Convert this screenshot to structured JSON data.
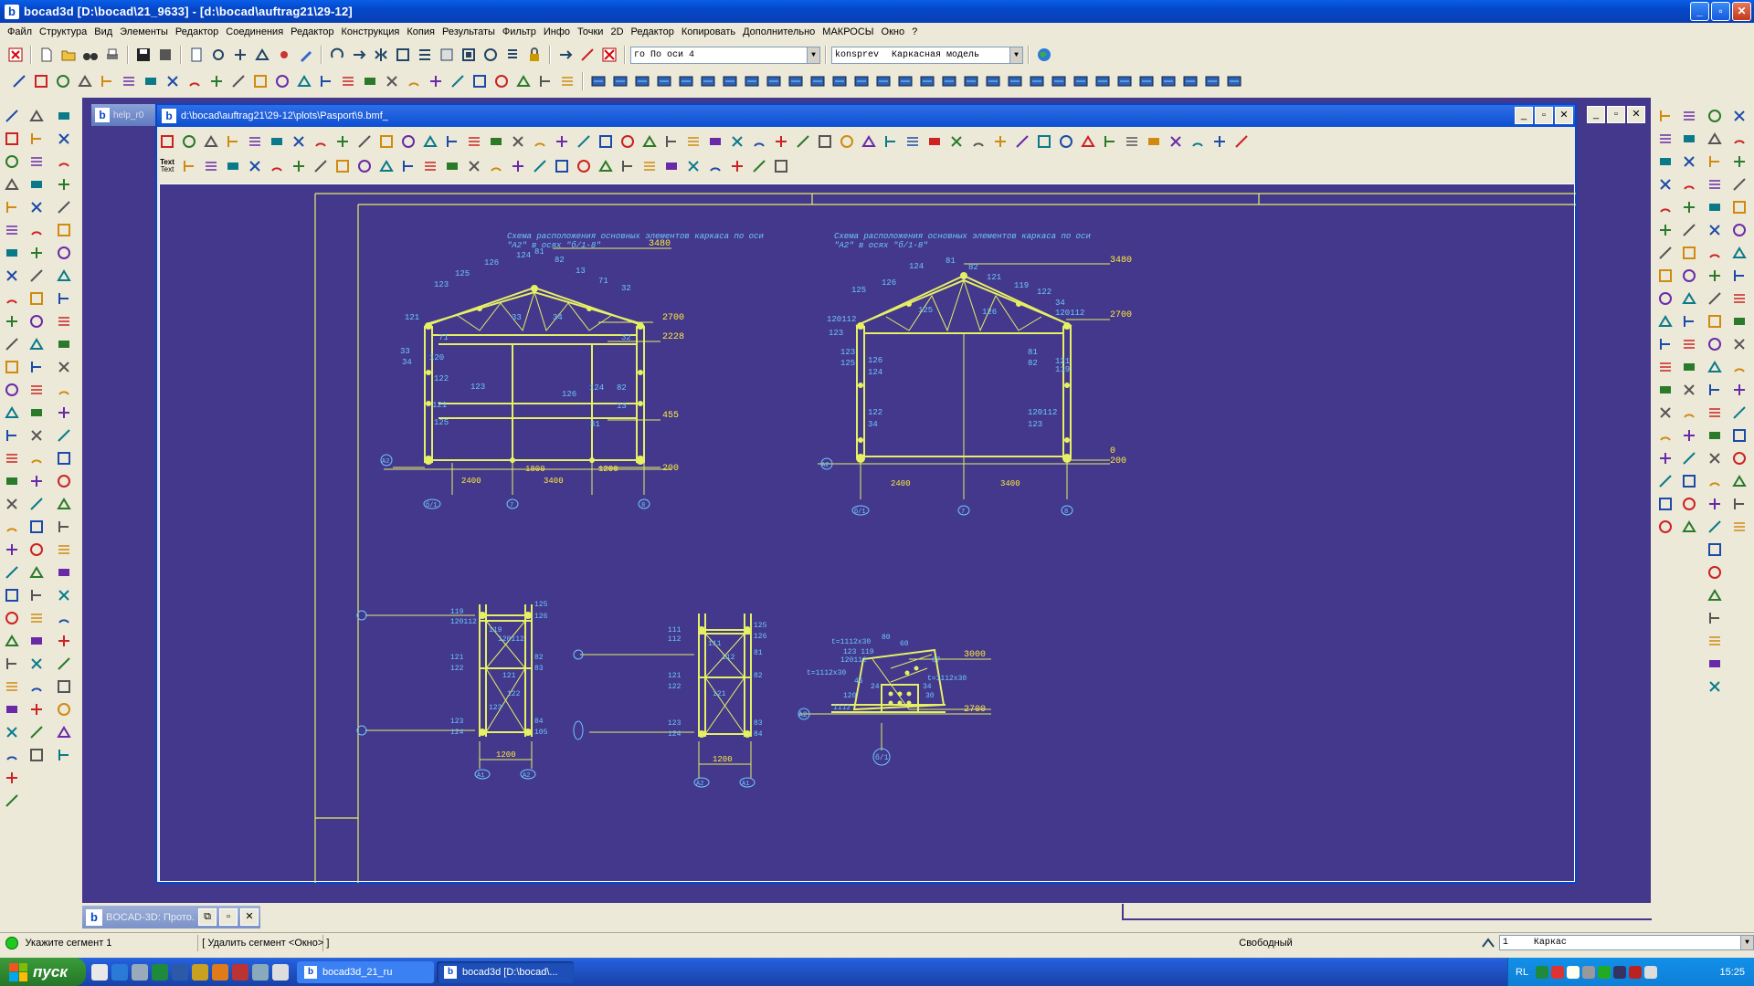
{
  "window": {
    "title": "bocad3d  [D:\\bocad\\21_9633]  - [d:\\bocad\\auftrag21\\29-12]",
    "app_letter": "b"
  },
  "menu": [
    "Файл",
    "Структура",
    "Вид",
    "Элементы",
    "Редактор",
    "Соединения",
    "Редактор",
    "Конструкция",
    "Копия",
    "Результаты",
    "Фильтр",
    "Инфо",
    "Точки",
    "2D",
    "Редактор",
    "Копировать",
    "Дополнительно",
    "МАКРОСЫ",
    "Окно",
    "?"
  ],
  "toolbar": {
    "view_combo": "го По оси 4",
    "layer_combo": "konsprev",
    "model_combo": "Каркасная модель"
  },
  "child": {
    "title": "d:\\bocad\\auftrag21\\29-12\\plots\\Pasport\\9.bmf_",
    "help_tab": "help_r0",
    "text_tool_top": "Text",
    "text_tool_bottom": "Text"
  },
  "drawing": {
    "frame_title_1": "Схема расположения основных элементов каркаса по оси",
    "frame_sub_1": "\"А2\" в осях \"б/1-8\"",
    "frame_title_2": "Схема расположения основных элементов каркаса по оси",
    "frame_sub_2": "\"А2\" в осях \"б/1-8\"",
    "elev": {
      "top": "3480",
      "eave": "2700",
      "mid": "2228",
      "low": "455",
      "base": "200",
      "base2": "0"
    },
    "dims_1": [
      "2400",
      "3400",
      "1800",
      "1200"
    ],
    "dims_2": [
      "2400",
      "3400"
    ],
    "axes_1": [
      "б/1",
      "7",
      "8"
    ],
    "axes_2": [
      "б/1",
      "7",
      "8"
    ],
    "axis_left": "А2",
    "members_frame1": [
      "121",
      "123",
      "125",
      "126",
      "124",
      "81",
      "82",
      "13",
      "71",
      "32",
      "33",
      "34",
      "120",
      "122"
    ],
    "members_frame2": [
      "120112",
      "123",
      "125",
      "126",
      "124",
      "81",
      "82",
      "121",
      "119",
      "122",
      "34"
    ],
    "section_1": {
      "dim": "1200",
      "axes": [
        "А1",
        "А2"
      ],
      "members": [
        "119",
        "120112",
        "121",
        "122",
        "123",
        "124",
        "125",
        "126",
        "82",
        "83",
        "84",
        "105"
      ]
    },
    "section_2": {
      "dim": "1200",
      "axes": [
        "А2",
        "А1"
      ],
      "members": [
        "111",
        "112",
        "121",
        "122",
        "123",
        "124",
        "125",
        "126",
        "81",
        "82",
        "83",
        "84"
      ]
    },
    "node": {
      "label_1": "t=1112x30",
      "label_2": "123 119",
      "label_3": "120112",
      "label_4": "t=1112x30",
      "label_5": "t=1112x30",
      "label_6": "1112",
      "label_7": "120",
      "elev_top": "3000",
      "elev_low": "2700",
      "axis": "б/1",
      "nums": [
        "80",
        "60",
        "67",
        "34",
        "46",
        "24",
        "30"
      ]
    }
  },
  "proto": {
    "label": "BOCAD-3D: Прото..."
  },
  "status": {
    "msg": "Укажите сегмент 1",
    "hint": "[ Удалить сегмент <Окно> ]",
    "mode": "Свободный",
    "layer_num": "1",
    "layer_name": "Каркас"
  },
  "taskbar": {
    "start": "пуск",
    "tasks": [
      "bocad3d_21_ru",
      "bocad3d  [D:\\bocad\\..."
    ],
    "lang": "RL",
    "clock": "15:25"
  },
  "colors": {
    "drawing_bg": "#43388c",
    "line": "#e6f064",
    "text": "#6ec8ff",
    "dim_yellow": "#ffea3a"
  }
}
